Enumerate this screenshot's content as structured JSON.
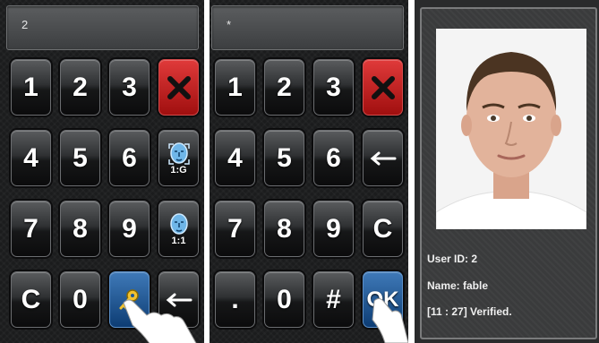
{
  "panel1": {
    "display_value": "2",
    "keys": [
      {
        "label": "1"
      },
      {
        "label": "2"
      },
      {
        "label": "3"
      },
      {
        "label": "",
        "icon": "close-icon"
      },
      {
        "label": "4"
      },
      {
        "label": "5"
      },
      {
        "label": "6"
      },
      {
        "label": "1:G",
        "icon": "face-icon"
      },
      {
        "label": "7"
      },
      {
        "label": "8"
      },
      {
        "label": "9"
      },
      {
        "label": "1:1",
        "icon": "face-icon"
      },
      {
        "label": "C"
      },
      {
        "label": "0"
      },
      {
        "label": "",
        "icon": "key-icon"
      },
      {
        "label": "",
        "icon": "backspace-arrow-icon"
      }
    ]
  },
  "panel2": {
    "display_value": "*",
    "keys": [
      {
        "label": "1"
      },
      {
        "label": "2"
      },
      {
        "label": "3"
      },
      {
        "label": "",
        "icon": "close-icon"
      },
      {
        "label": "4"
      },
      {
        "label": "5"
      },
      {
        "label": "6"
      },
      {
        "label": "",
        "icon": "backspace-arrow-icon"
      },
      {
        "label": "7"
      },
      {
        "label": "8"
      },
      {
        "label": "9"
      },
      {
        "label": "C"
      },
      {
        "label": "."
      },
      {
        "label": "0"
      },
      {
        "label": "#"
      },
      {
        "label": "OK"
      }
    ]
  },
  "verification": {
    "user_id": "User ID: 2",
    "name": "Name: fable",
    "status": "[11 : 27] Verified."
  },
  "colors": {
    "cancel_red": "#b71616",
    "highlight_blue": "#1c5698",
    "panel_bg": "#1b1c1d"
  }
}
